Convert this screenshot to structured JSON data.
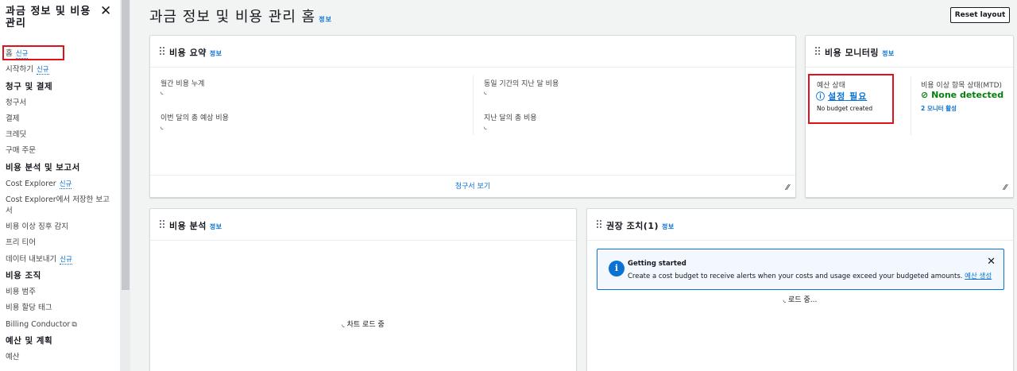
{
  "sidebar": {
    "title": "과금 정보 및 비용 관리",
    "close_icon": "close-icon",
    "new_badge": "신규",
    "items": [
      {
        "type": "item",
        "label": "홈",
        "badge": "신규",
        "highlighted": true
      },
      {
        "type": "item",
        "label": "시작하기",
        "badge": "신규"
      },
      {
        "type": "section",
        "label": "청구 및 결제"
      },
      {
        "type": "item",
        "label": "청구서"
      },
      {
        "type": "item",
        "label": "결제"
      },
      {
        "type": "item",
        "label": "크레딧"
      },
      {
        "type": "item",
        "label": "구매 주문"
      },
      {
        "type": "section",
        "label": "비용 분석 및 보고서"
      },
      {
        "type": "item",
        "label": "Cost Explorer",
        "badge": "신규"
      },
      {
        "type": "item",
        "label": "Cost Explorer에서 저장한 보고서",
        "wrap": true
      },
      {
        "type": "item",
        "label": "비용 이상 징후 감지"
      },
      {
        "type": "item",
        "label": "프리 티어"
      },
      {
        "type": "item",
        "label": "데이터 내보내기",
        "badge": "신규"
      },
      {
        "type": "section",
        "label": "비용 조직"
      },
      {
        "type": "item",
        "label": "비용 범주"
      },
      {
        "type": "item",
        "label": "비용 할당 태그"
      },
      {
        "type": "item",
        "label": "Billing Conductor",
        "external": true
      },
      {
        "type": "section",
        "label": "예산 및 계획"
      },
      {
        "type": "item",
        "label": "예산"
      }
    ]
  },
  "header": {
    "title": "과금 정보 및 비용 관리 홈",
    "info": "정보",
    "reset_label": "Reset layout"
  },
  "cost_summary": {
    "title": "비용 요약",
    "info": "정보",
    "metrics": [
      {
        "label": "월간 비용 누계",
        "value": "◟"
      },
      {
        "label": "동일 기간의 지난 달 비용",
        "value": "◟"
      },
      {
        "label": "이번 달의 총 예상 비용",
        "value": "◟"
      },
      {
        "label": "지난 달의 총 비용",
        "value": "◟"
      }
    ],
    "footer_link": "청구서 보기"
  },
  "cost_monitoring": {
    "title": "비용 모니터링",
    "info": "정보",
    "budget_label": "예산 상태",
    "budget_status": "설정 필요",
    "budget_sub": "No budget created",
    "anomaly_label": "비용 이상 항목 상태(MTD)",
    "anomaly_status": "None detected",
    "anomaly_sub": "2 모니터 활성"
  },
  "cost_analysis": {
    "title": "비용 분석",
    "info": "정보",
    "loading": "차트 로드 중"
  },
  "recommendations": {
    "title": "권장 조치(1)",
    "info": "정보",
    "alert_title": "Getting started",
    "alert_text": "Create a cost budget to receive alerts when your costs and usage exceed your budgeted amounts.",
    "alert_link": "예산 생성",
    "loading": "로드 중..."
  },
  "colors": {
    "accent": "#0972d3",
    "success": "#037f0c",
    "highlight": "#e0111a"
  }
}
